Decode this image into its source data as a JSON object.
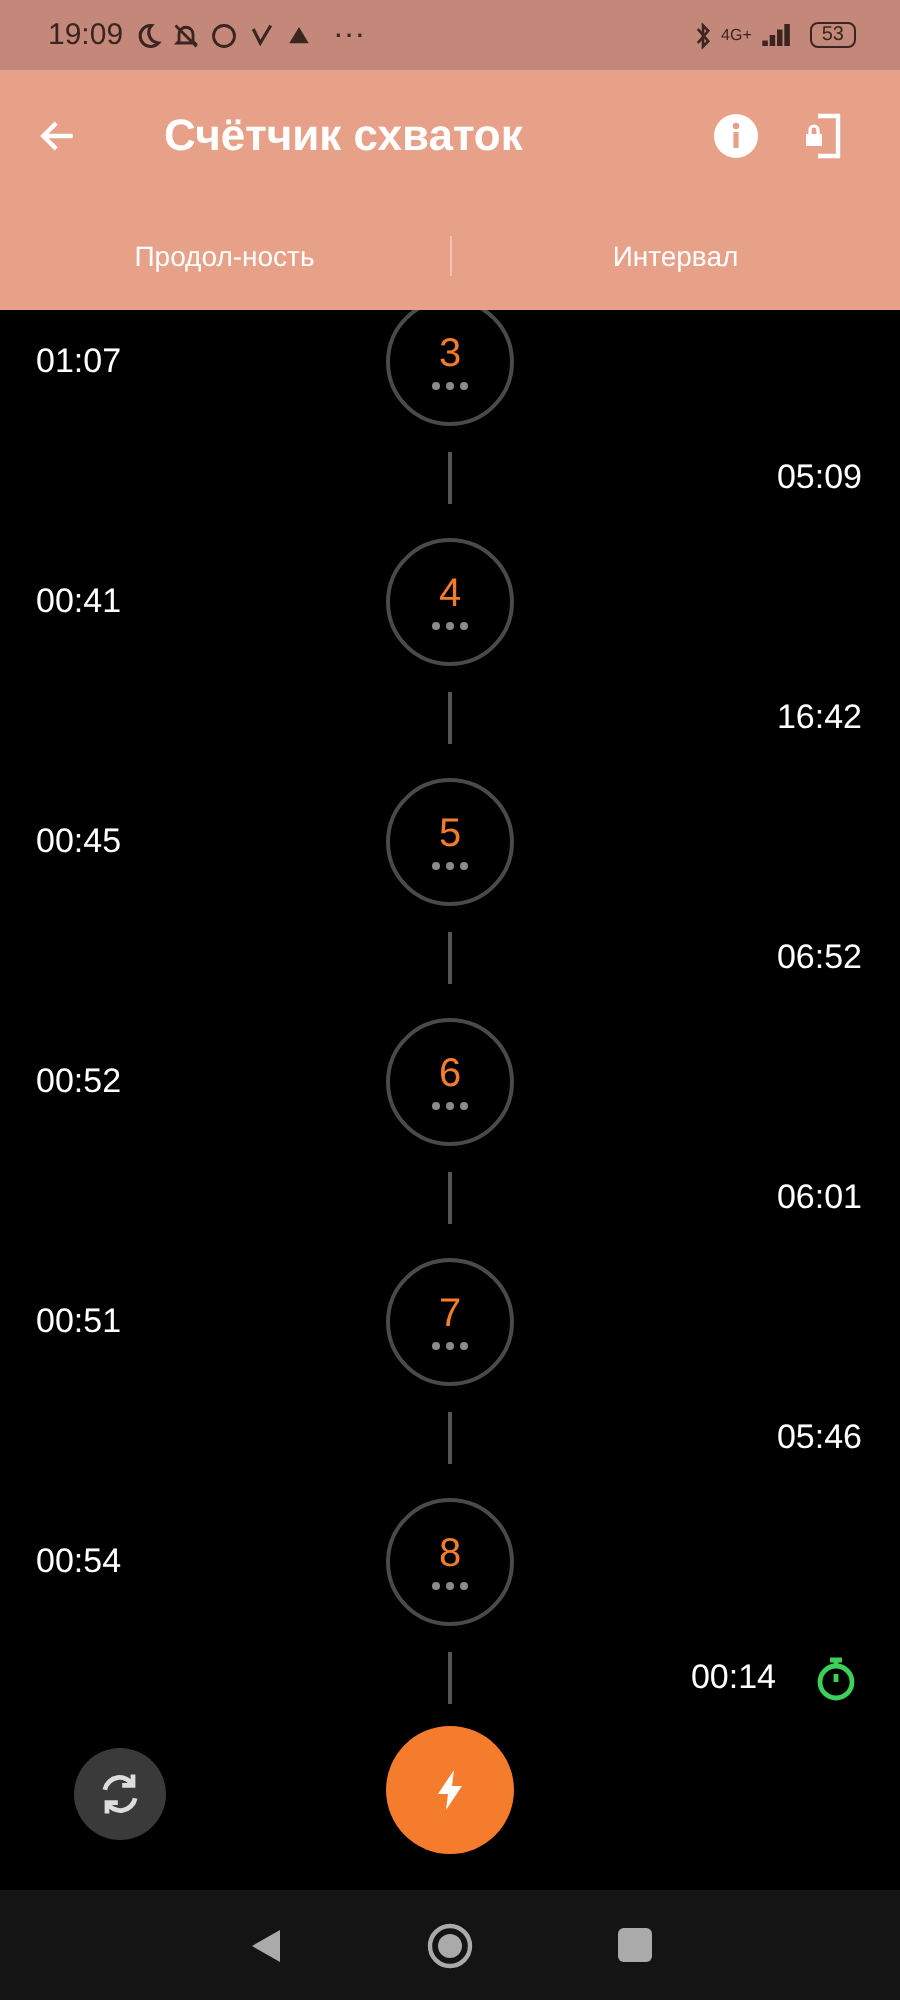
{
  "status_bar": {
    "time": "19:09",
    "more": "···",
    "network": "4G+",
    "battery": "53"
  },
  "app_bar": {
    "title": "Счётчик схваток"
  },
  "tabs": [
    {
      "label": "Продол-ность"
    },
    {
      "label": "Интервал"
    }
  ],
  "timeline": [
    {
      "kind": "contraction",
      "number": "3",
      "duration": "01:07"
    },
    {
      "kind": "interval",
      "value": "05:09",
      "running": false
    },
    {
      "kind": "contraction",
      "number": "4",
      "duration": "00:41"
    },
    {
      "kind": "interval",
      "value": "16:42",
      "running": false
    },
    {
      "kind": "contraction",
      "number": "5",
      "duration": "00:45"
    },
    {
      "kind": "interval",
      "value": "06:52",
      "running": false
    },
    {
      "kind": "contraction",
      "number": "6",
      "duration": "00:52"
    },
    {
      "kind": "interval",
      "value": "06:01",
      "running": false
    },
    {
      "kind": "contraction",
      "number": "7",
      "duration": "00:51"
    },
    {
      "kind": "interval",
      "value": "05:46",
      "running": false
    },
    {
      "kind": "contraction",
      "number": "8",
      "duration": "00:54"
    },
    {
      "kind": "interval",
      "value": "00:14",
      "running": true
    }
  ]
}
